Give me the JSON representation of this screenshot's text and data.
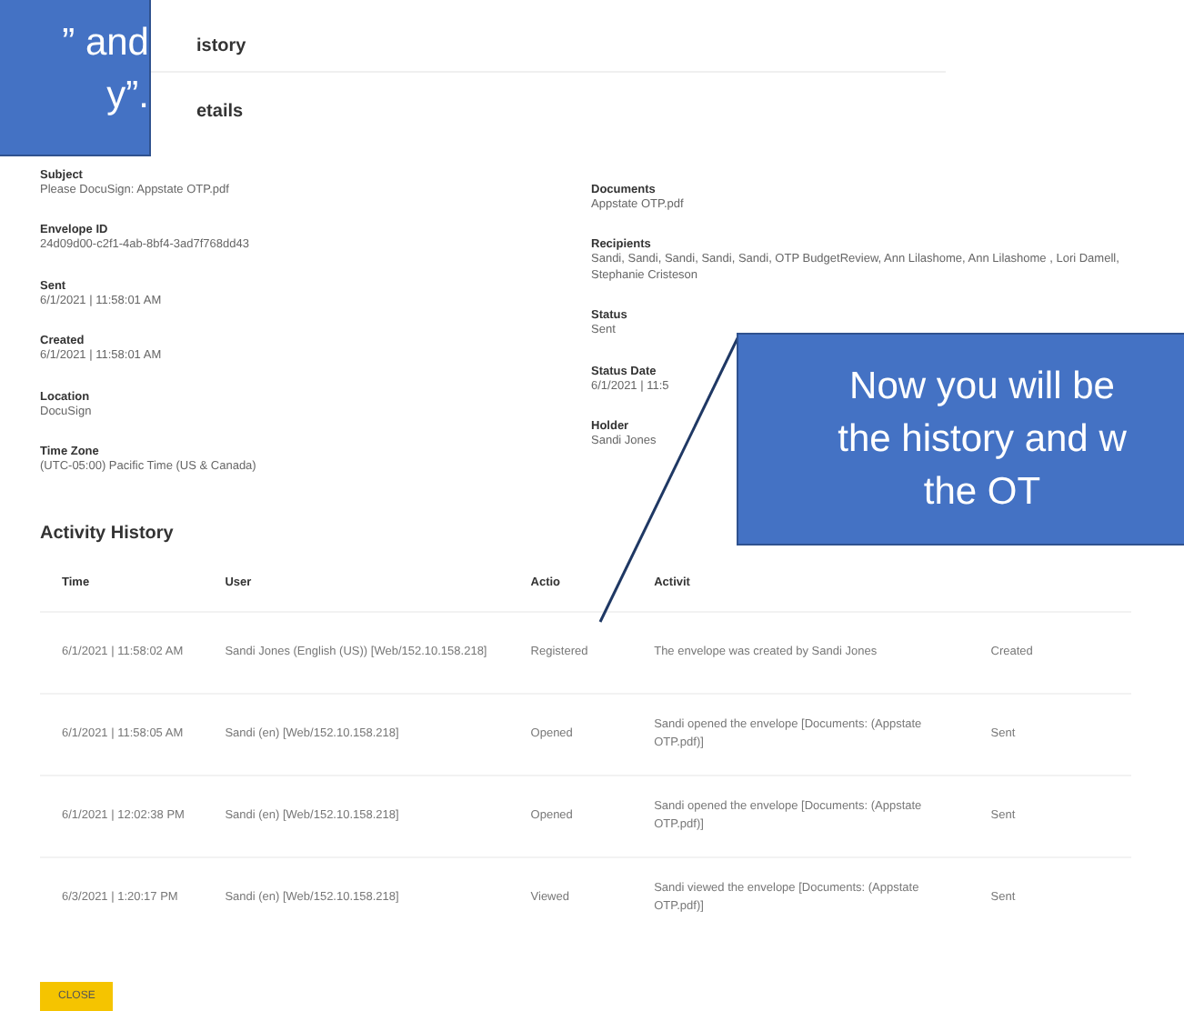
{
  "page_title": "istory",
  "details_title": "etails",
  "details_left": [
    {
      "label": "Subject",
      "value": "Please DocuSign: Appstate OTP.pdf"
    },
    {
      "label": "Envelope ID",
      "value": "24d09d00-c2f1-4ab-8bf4-3ad7f768dd43"
    },
    {
      "label": "Sent",
      "value": "6/1/2021 | 11:58:01 AM"
    },
    {
      "label": "Created",
      "value": "6/1/2021 | 11:58:01 AM"
    },
    {
      "label": "Location",
      "value": "DocuSign"
    },
    {
      "label": "Time Zone",
      "value": "(UTC-05:00) Pacific Time (US & Canada)"
    }
  ],
  "details_right": [
    {
      "label": "Documents",
      "value": "Appstate OTP.pdf"
    },
    {
      "label": "Recipients",
      "value": "Sandi, Sandi, Sandi, Sandi, Sandi, OTP BudgetReview, Ann Lilashome, Ann Lilashome , Lori Damell, Stephanie Cristeson"
    },
    {
      "label": "Status",
      "value": "Sent"
    },
    {
      "label": "Status Date",
      "value": "6/1/2021 | 11:5"
    },
    {
      "label": "Holder",
      "value": "Sandi Jones"
    }
  ],
  "activity_title": "Activity History",
  "table": {
    "columns": [
      "Time",
      "User",
      "Actio",
      "Activit"
    ],
    "rows": [
      {
        "time": "6/1/2021 | 11:58:02 AM",
        "user": "Sandi Jones (English (US)) [Web/152.10.158.218]",
        "action": "Registered",
        "activity": "The envelope was created by Sandi Jones",
        "status": "Created"
      },
      {
        "time": "6/1/2021 | 11:58:05 AM",
        "user": "Sandi (en) [Web/152.10.158.218]",
        "action": "Opened",
        "activity": "Sandi opened the envelope [Documents: (Appstate OTP.pdf)]",
        "status": "Sent"
      },
      {
        "time": "6/1/2021 | 12:02:38 PM",
        "user": "Sandi (en) [Web/152.10.158.218]",
        "action": "Opened",
        "activity": "Sandi opened the envelope [Documents: (Appstate OTP.pdf)]",
        "status": "Sent"
      },
      {
        "time": "6/3/2021 | 1:20:17 PM",
        "user": "Sandi (en) [Web/152.10.158.218]",
        "action": "Viewed",
        "activity": "Sandi viewed the envelope [Documents: (Appstate OTP.pdf)]",
        "status": "Sent"
      }
    ]
  },
  "close_button": "CLOSE",
  "callouts": [
    {
      "lines": [
        "” and",
        "y”."
      ]
    },
    {
      "lines": [
        "Now you will be",
        "the history and w",
        "the OT"
      ]
    }
  ]
}
